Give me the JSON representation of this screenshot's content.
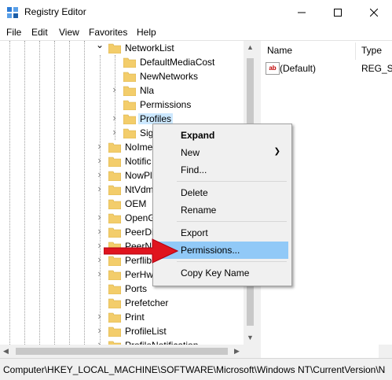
{
  "window": {
    "title": "Registry Editor"
  },
  "menubar": [
    "File",
    "Edit",
    "View",
    "Favorites",
    "Help"
  ],
  "tree": {
    "items": [
      {
        "label": "NetworkList",
        "expander": "open"
      },
      {
        "label": "DefaultMediaCost",
        "expander": "none"
      },
      {
        "label": "NewNetworks",
        "expander": "none"
      },
      {
        "label": "Nla",
        "expander": "closed"
      },
      {
        "label": "Permissions",
        "expander": "none"
      },
      {
        "label": "Profiles",
        "expander": "closed"
      },
      {
        "label": "Sig",
        "expander": "closed"
      },
      {
        "label": "NoIme",
        "expander": "closed"
      },
      {
        "label": "Notific",
        "expander": "closed"
      },
      {
        "label": "NowPl",
        "expander": "closed"
      },
      {
        "label": "NtVdm",
        "expander": "closed"
      },
      {
        "label": "OEM",
        "expander": "none"
      },
      {
        "label": "OpenG",
        "expander": "closed"
      },
      {
        "label": "PeerDi",
        "expander": "closed"
      },
      {
        "label": "PeerN",
        "expander": "closed"
      },
      {
        "label": "Perflib",
        "expander": "closed"
      },
      {
        "label": "PerHw",
        "expander": "closed"
      },
      {
        "label": "Ports",
        "expander": "none"
      },
      {
        "label": "Prefetcher",
        "expander": "none"
      },
      {
        "label": "Print",
        "expander": "closed"
      },
      {
        "label": "ProfileList",
        "expander": "closed"
      },
      {
        "label": "ProfileNotification",
        "expander": "closed"
      }
    ]
  },
  "values": {
    "columns": {
      "name": "Name",
      "type": "Type"
    },
    "rows": [
      {
        "name": "(Default)",
        "type": "REG_SZ"
      }
    ]
  },
  "context_menu": {
    "expand": "Expand",
    "new": "New",
    "find": "Find...",
    "delete": "Delete",
    "rename": "Rename",
    "export": "Export",
    "permissions": "Permissions...",
    "copy_key_name": "Copy Key Name"
  },
  "statusbar": {
    "path": "Computer\\HKEY_LOCAL_MACHINE\\SOFTWARE\\Microsoft\\Windows NT\\CurrentVersion\\N"
  },
  "colors": {
    "highlight": "#91c9f7",
    "selection": "#cce8ff",
    "arrow": "#e0141e",
    "folder": "#f3cd6b"
  }
}
